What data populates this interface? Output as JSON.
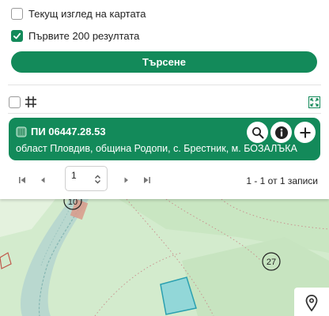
{
  "options": {
    "current_view_label": "Текущ изглед на картата",
    "current_view_checked": false,
    "first_200_label": "Първите 200 резултата",
    "first_200_checked": true
  },
  "search_button": {
    "label": "Търсене"
  },
  "result_toolbar": {
    "select_all_checked": false,
    "grid_icon": "grid-icon",
    "fit_extent_icon": "fit-extent-icon"
  },
  "result": {
    "title": "ПИ 06447.28.53",
    "address": "област Пловдив, община Родопи, с. Брестник, м. БОЗАЛЪКА",
    "actions": [
      "search-icon",
      "info-icon",
      "plus-icon"
    ]
  },
  "pager": {
    "first_icon": "first-page-icon",
    "prev_icon": "prev-page-icon",
    "page_value": "1",
    "next_icon": "next-page-icon",
    "last_icon": "last-page-icon",
    "records_text": "1 - 1 от 1 записи"
  },
  "map": {
    "labels": [
      "10",
      "27"
    ],
    "location_icon": "location-pin-icon",
    "colors": {
      "terrain": "#cfe8c8",
      "parcel": "#7fcfd6",
      "accent": "#138a5a"
    }
  }
}
